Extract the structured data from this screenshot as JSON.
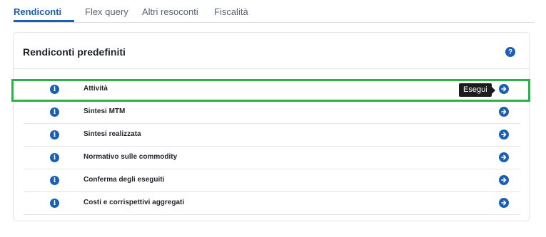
{
  "tabs": [
    {
      "label": "Rendiconti",
      "active": true
    },
    {
      "label": "Flex query",
      "active": false
    },
    {
      "label": "Altri resoconti",
      "active": false
    },
    {
      "label": "Fiscalità",
      "active": false
    }
  ],
  "card": {
    "title": "Rendiconti predefiniti",
    "help_icon": "?",
    "info_icon": "i",
    "rows": [
      {
        "label": "Attività"
      },
      {
        "label": "Sintesi MTM"
      },
      {
        "label": "Sintesi realizzata"
      },
      {
        "label": "Normativo sulle commodity"
      },
      {
        "label": "Conferma degli eseguiti"
      },
      {
        "label": "Costi e corrispettivi aggregati"
      }
    ]
  },
  "tooltip": {
    "text": "Esegui"
  },
  "colors": {
    "accent": "#1a5fb4",
    "highlight": "#2db14a"
  }
}
